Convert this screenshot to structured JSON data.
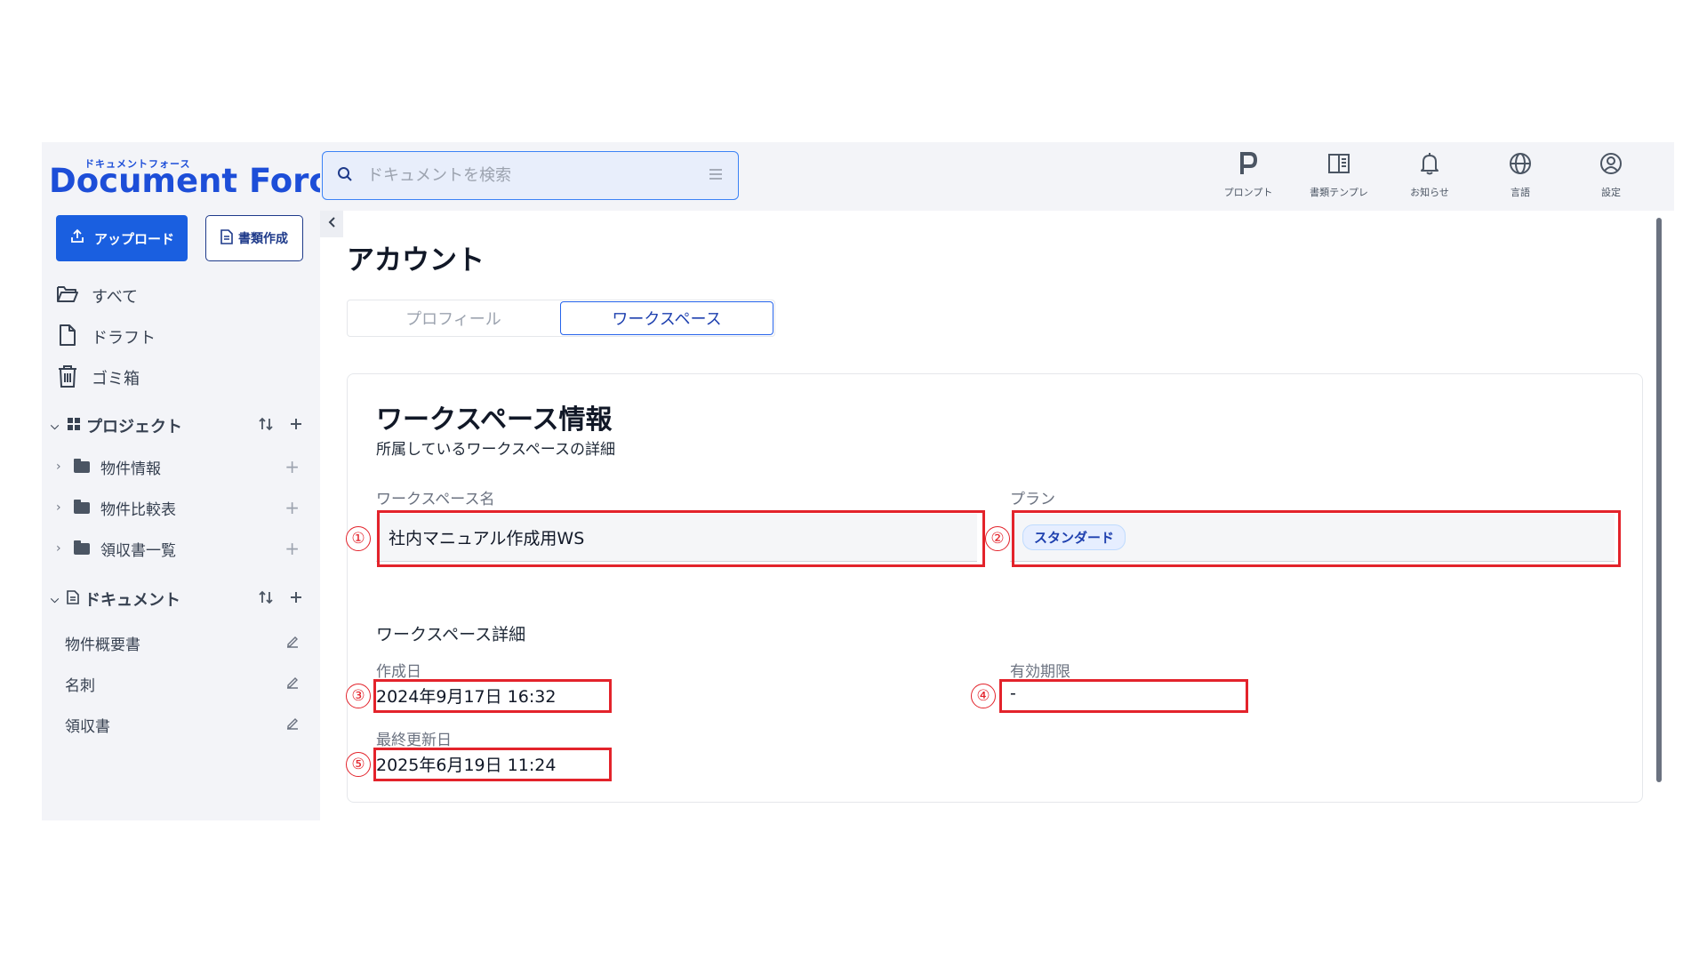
{
  "brand": {
    "kana": "ドキュメントフォース",
    "name": "Document Force"
  },
  "sidebar": {
    "upload_label": "アップロード",
    "create_label": "書類作成",
    "nav": [
      {
        "label": "すべて",
        "icon": "folder-open-icon"
      },
      {
        "label": "ドラフト",
        "icon": "file-icon"
      },
      {
        "label": "ゴミ箱",
        "icon": "trash-icon"
      }
    ],
    "projects": {
      "title": "プロジェクト",
      "items": [
        {
          "label": "物件情報"
        },
        {
          "label": "物件比較表"
        },
        {
          "label": "領収書一覧"
        }
      ]
    },
    "documents": {
      "title": "ドキュメント",
      "items": [
        {
          "label": "物件概要書"
        },
        {
          "label": "名刺"
        },
        {
          "label": "領収書"
        }
      ]
    }
  },
  "topbar": {
    "search_placeholder": "ドキュメントを検索",
    "icons": [
      {
        "label": "プロンプト",
        "icon": "prompt-p-icon"
      },
      {
        "label": "書類テンプレ",
        "icon": "template-book-icon"
      },
      {
        "label": "お知らせ",
        "icon": "bell-icon"
      },
      {
        "label": "言語",
        "icon": "globe-icon"
      },
      {
        "label": "設定",
        "icon": "user-circle-icon"
      }
    ]
  },
  "main": {
    "title": "アカウント",
    "tabs": [
      {
        "label": "プロフィール",
        "active": false
      },
      {
        "label": "ワークスペース",
        "active": true
      }
    ],
    "card": {
      "title": "ワークスペース情報",
      "subtitle": "所属しているワークスペースの詳細",
      "workspace_name_label": "ワークスペース名",
      "workspace_name_value": "社内マニュアル作成用WS",
      "plan_label": "プラン",
      "plan_value": "スタンダード",
      "details_title": "ワークスペース詳細",
      "created_label": "作成日",
      "created_value": "2024年9月17日 16:32",
      "expiry_label": "有効期限",
      "expiry_value": "-",
      "updated_label": "最終更新日",
      "updated_value": "2025年6月19日 11:24"
    }
  },
  "annotations": [
    "①",
    "②",
    "③",
    "④",
    "⑤"
  ],
  "colors": {
    "accent": "#1a5fe0",
    "highlight": "#e3232b",
    "sidebar_bg": "#f3f4f8"
  }
}
